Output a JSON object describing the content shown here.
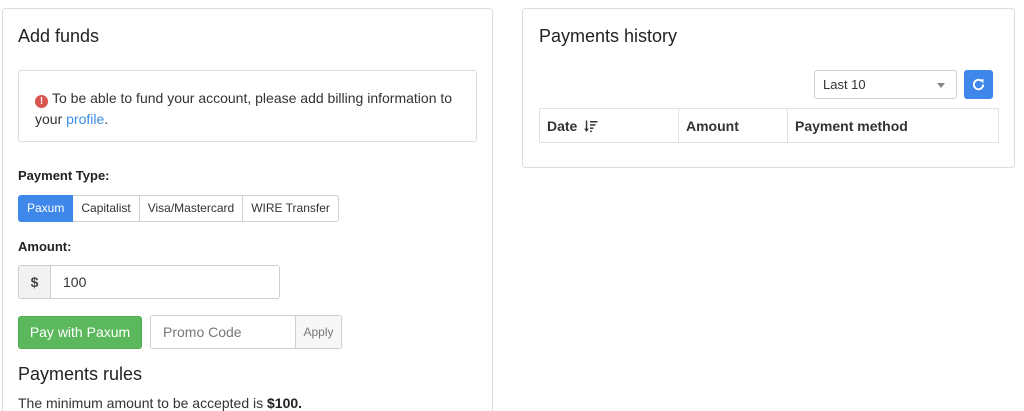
{
  "add_funds": {
    "title": "Add funds",
    "alert": {
      "text_before": "To be able to fund your account, please add billing information to your",
      "link_text": "profile",
      "text_after": "."
    },
    "payment_type_label": "Payment Type:",
    "payment_types": [
      {
        "label": "Paxum",
        "active": true
      },
      {
        "label": "Capitalist",
        "active": false
      },
      {
        "label": "Visa/Mastercard",
        "active": false
      },
      {
        "label": "WIRE Transfer",
        "active": false
      }
    ],
    "amount_label": "Amount:",
    "currency_symbol": "$",
    "amount_value": "100",
    "pay_button": "Pay with Paxum",
    "promo_placeholder": "Promo Code",
    "apply_button": "Apply",
    "rules_title": "Payments rules",
    "rules_text_before": "The minimum amount to be accepted is",
    "rules_amount": "$100."
  },
  "payments_history": {
    "title": "Payments history",
    "filter_selected": "Last 10",
    "refresh_icon": "refresh-icon",
    "columns": [
      "Date",
      "Amount",
      "Payment method"
    ],
    "sort_icon": "sort-desc-icon"
  },
  "colors": {
    "primary": "#3f87ea",
    "success": "#5cb85c",
    "danger": "#d9534f",
    "link": "#3a8ee6"
  }
}
